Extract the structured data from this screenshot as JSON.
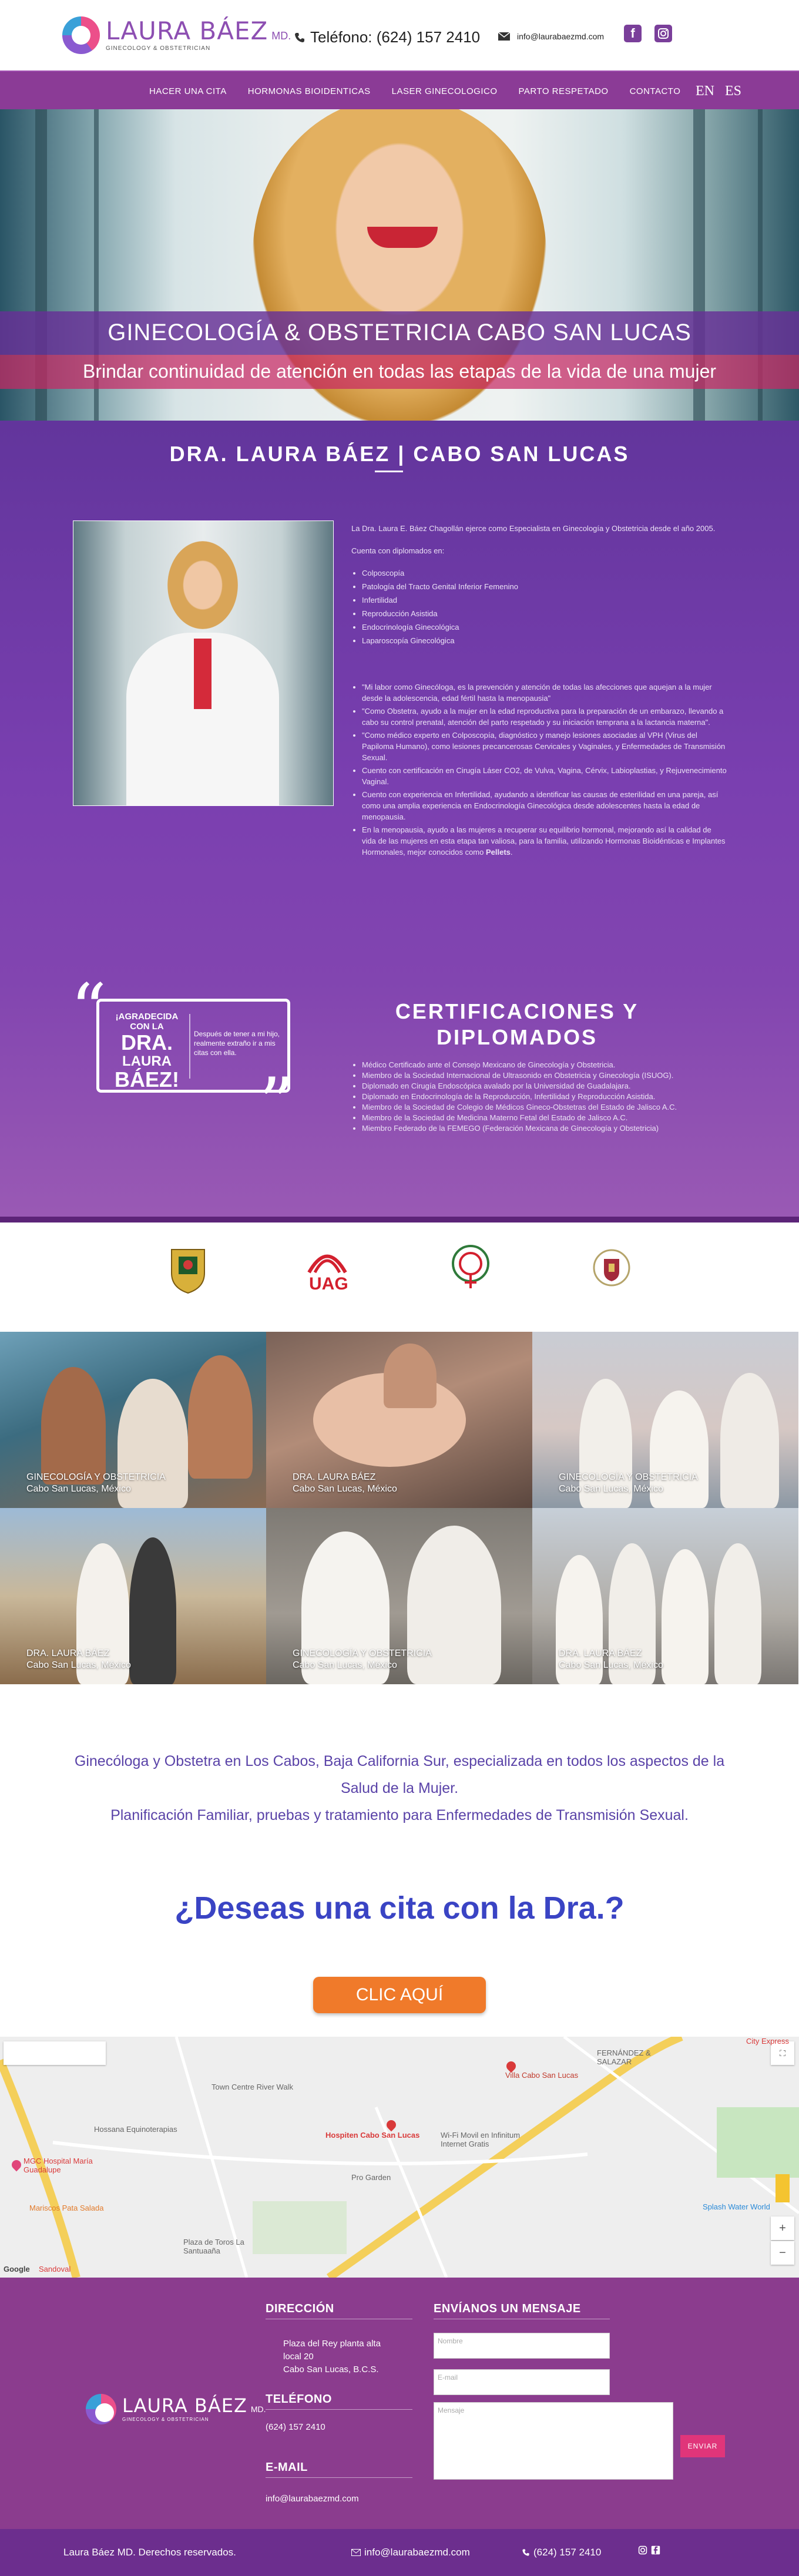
{
  "header": {
    "brand_name": "LAURA BÁEZ",
    "brand_suffix": "MD.",
    "brand_tagline": "GINECOLOGY & OBSTETRICIAN",
    "phone": "Teléfono: (624) 157 2410",
    "email": "info@laurabaezmd.com",
    "social": [
      "facebook-icon",
      "instagram-icon"
    ]
  },
  "nav": {
    "items": [
      "HACER UNA CITA",
      "HORMONAS BIOIDENTICAS",
      "LASER GINECOLOGICO",
      "PARTO RESPETADO",
      "CONTACTO"
    ],
    "lang_en": "EN",
    "lang_es": "ES"
  },
  "hero": {
    "title": "GINECOLOGÍA & OBSTETRICIA CABO SAN LUCAS",
    "subtitle": "Brindar continuidad de atención en todas las etapas de la vida de una mujer"
  },
  "about": {
    "title": "DRA. LAURA BÁEZ | CABO SAN LUCAS",
    "intro": "La Dra. Laura E. Báez Chagollán ejerce como Especialista en Ginecología y Obstetricia desde el año 2005.",
    "diplomas_lead": "Cuenta con diplomados en:",
    "diplomas": [
      "Colposcopía",
      "Patología del Tracto Genital Inferior Femenino",
      "Infertilidad",
      "Reproducción Asistida",
      "Endocrinología Ginecológica",
      "Laparoscopía Ginecológica"
    ],
    "points": [
      "\"Mi labor como Ginecóloga, es la prevención y atención de todas las afecciones que aquejan a la mujer desde la adolescencia, edad fértil hasta la menopausia\"",
      "\"Como Obstetra, ayudo a la mujer en la edad reproductiva para la preparación de un embarazo, llevando a cabo su control prenatal, atención del parto respetado y su iniciación temprana a la lactancia materna\".",
      "\"Como médico experto en Colposcopía, diagnóstico y manejo lesiones asociadas al VPH (Virus del Papiloma Humano), como lesiones precancerosas Cervicales y Vaginales, y Enfermedades de Transmisión Sexual.",
      "Cuento con certificación en Cirugía Láser CO2, de Vulva, Vagina, Cérvix, Labioplastias, y Rejuvenecimiento Vaginal.",
      "Cuento con experiencia en Infertilidad, ayudando a identificar las causas de esterilidad en una pareja, así como una amplia experiencia en Endocrinología Ginecológica desde adolescentes hasta la edad de menopausia.",
      "En la menopausia, ayudo a las mujeres a recuperar su equilibrio hormonal, mejorando así la calidad de vida de las mujeres en esta etapa tan valiosa, para la familia, utilizando Hormonas Bioidénticas e Implantes Hormonales, mejor conocidos como"
    ],
    "pellets": "Pellets",
    "period": "."
  },
  "quote": {
    "line1": "¡AGRADECIDA CON LA",
    "line2": "DRA.",
    "line3": "LAURA",
    "line4": "BÁEZ!",
    "body": "Después de tener a mi hijo, realmente extraño ir a mis citas con ella."
  },
  "certifications": {
    "title": "CERTIFICACIONES Y DIPLOMADOS",
    "items": [
      "Médico Certificado ante el Consejo Mexicano de Ginecología y Obstetricia.",
      "Miembro de la Sociedad Internacional de Ultrasonido en Obstetricia y Ginecología (ISUOG).",
      "Diplomado en Cirugía Endoscópica avalado por la Universidad de Guadalajara.",
      "Diplomado en Endocrinología de la Reproducción, Infertilidad y Reproducción Asistida.",
      "Miembro de la Sociedad de Colegio de Médicos Gineco-Obstetras del Estado de Jalisco A.C.",
      "Miembro de la Sociedad de Medicina Materno Fetal del Estado de Jalisco A.C.",
      "Miembro Federado de la FEMEGO (Federación Mexicana de Ginecología y Obstetricia)"
    ]
  },
  "logos": {
    "uag": "UAG"
  },
  "gallery": [
    {
      "title": "GINECOLOGÍA Y OBSTETRICIA",
      "place": "Cabo San Lucas, México"
    },
    {
      "title": "DRA. LAURA BÁEZ",
      "place": "Cabo San Lucas, México"
    },
    {
      "title": "GINECOLOGÍA Y OBSTETRICIA",
      "place": "Cabo San Lucas, México"
    },
    {
      "title": "DRA. LAURA BÁEZ",
      "place": "Cabo San Lucas, México"
    },
    {
      "title": "GINECOLOGÍA Y OBSTETRICIA",
      "place": "Cabo San Lucas, México"
    },
    {
      "title": "DRA. LAURA BÁEZ",
      "place": "Cabo San Lucas, México"
    }
  ],
  "intro": {
    "line1": "Ginecóloga y Obstetra en Los Cabos, Baja California Sur, especializada en todos los aspectos de la Salud de la Mujer.",
    "line2": "Planificación Familiar, pruebas y tratamiento para Enfermedades de Transmisión Sexual.",
    "cta_question": "¿Deseas una cita con la Dra.?",
    "cta_button": "CLIC AQUÍ"
  },
  "map": {
    "labels": [
      "Town Centre River Walk",
      "Hospiten Cabo San Lucas",
      "Wi-Fi Movil en Infinitum Internet Gratis",
      "Pro Garden",
      "Villa Cabo San Lucas",
      "FERNÁNDEZ & SALAZAR",
      "Hossana Equinoterapias",
      "MGC Hospital María Guadalupe",
      "Mariscos Pata Salada",
      "Plaza de Toros La Santuaaña",
      "Splash Water World",
      "City Express",
      "Google",
      "Sandoval"
    ]
  },
  "footer": {
    "address_title": "DIRECCIÓN",
    "address_lines": [
      "Plaza del Rey planta alta",
      "local 20",
      "Cabo San Lucas, B.C.S."
    ],
    "phone_title": "TELÉFONO",
    "phone": "(624) 157 2410",
    "email_title": "E-MAIL",
    "email": "info@laurabaezmd.com",
    "form_title": "ENVÍANOS UN MENSAJE",
    "name_placeholder": "Nombre",
    "email_placeholder": "E-mail",
    "message_placeholder": "Mensaje",
    "send": "ENVIAR"
  },
  "bottom": {
    "copyright": "Laura Báez MD. Derechos reservados.",
    "email": "info@laurabaezmd.com",
    "phone": "(624) 157 2410"
  },
  "colors": {
    "brand_purple": "#8b3b96",
    "accent_pink": "#e0357a",
    "cta_orange": "#f07a2a",
    "title_blue": "#3a44c4"
  }
}
